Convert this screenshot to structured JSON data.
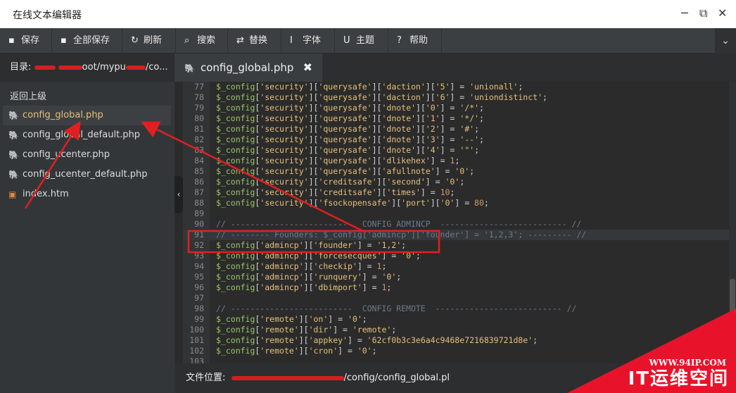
{
  "window": {
    "title": "在线文本编辑器",
    "min_icon": "─",
    "max_icon": "⧉",
    "close_icon": "✕"
  },
  "toolbar": {
    "buttons": [
      {
        "icon": "save-icon",
        "glyph": "▪",
        "label": "保存"
      },
      {
        "icon": "save-all-icon",
        "glyph": "▪",
        "label": "全部保存"
      },
      {
        "icon": "refresh-icon",
        "glyph": "↻",
        "label": "刷新"
      },
      {
        "icon": "search-icon",
        "glyph": "⌕",
        "label": "搜索"
      },
      {
        "icon": "replace-icon",
        "glyph": "⇄",
        "label": "替换"
      },
      {
        "icon": "font-icon",
        "glyph": "I",
        "label": "字体"
      },
      {
        "icon": "theme-icon",
        "glyph": "U",
        "label": "主题"
      },
      {
        "icon": "help-icon",
        "glyph": "?",
        "label": "帮助"
      }
    ],
    "more_glyph": "⌄"
  },
  "sidebar": {
    "dir_label": "目录:",
    "dir_mid": "oot/mypu",
    "dir_end": "/co...",
    "back": "返回上级",
    "files": [
      {
        "name": "config_global.php",
        "type": "php",
        "active": true
      },
      {
        "name": "config_global_default.php",
        "type": "php"
      },
      {
        "name": "config_ucenter.php",
        "type": "php"
      },
      {
        "name": "config_ucenter_default.php",
        "type": "php"
      },
      {
        "name": "index.htm",
        "type": "htm"
      }
    ],
    "collapse_glyph": "‹"
  },
  "tab": {
    "name": "config_global.php",
    "close": "✖"
  },
  "editor": {
    "lines": [
      {
        "n": "77",
        "t": "$_config['security']['querysafe']['daction']['5'] = 'unionall';"
      },
      {
        "n": "78",
        "t": "$_config['security']['querysafe']['daction']['6'] = 'uniondistinct';"
      },
      {
        "n": "79",
        "t": "$_config['security']['querysafe']['dnote']['0'] = '/*';"
      },
      {
        "n": "80",
        "t": "$_config['security']['querysafe']['dnote']['1'] = '*/';"
      },
      {
        "n": "81",
        "t": "$_config['security']['querysafe']['dnote']['2'] = '#';"
      },
      {
        "n": "82",
        "t": "$_config['security']['querysafe']['dnote']['3'] = '--';"
      },
      {
        "n": "83",
        "t": "$_config['security']['querysafe']['dnote']['4'] = '\"';"
      },
      {
        "n": "84",
        "t": "$_config['security']['querysafe']['dlikehex'] = 1;"
      },
      {
        "n": "85",
        "t": "$_config['security']['querysafe']['afullnote'] = '0';"
      },
      {
        "n": "86",
        "t": "$_config['security']['creditsafe']['second'] = '0';"
      },
      {
        "n": "87",
        "t": "$_config['security']['creditsafe']['times'] = 10;"
      },
      {
        "n": "88",
        "t": "$_config['security']['fsockopensafe']['port']['0'] = 80;"
      },
      {
        "n": "89",
        "t": ""
      },
      {
        "n": "90",
        "t": "// -------------------------  CONFIG ADMINCP  -------------------------- //"
      },
      {
        "n": "91",
        "t": "// -------- Founders: $_config['admincp']['founder'] = '1,2,3'; --------- //"
      },
      {
        "n": "92",
        "t": "$_config['admincp']['founder'] = '1,2';"
      },
      {
        "n": "93",
        "t": "$_config['admincp']['forcesecques'] = '0';"
      },
      {
        "n": "94",
        "t": "$_config['admincp']['checkip'] = 1;"
      },
      {
        "n": "95",
        "t": "$_config['admincp']['runquery'] = '0';"
      },
      {
        "n": "96",
        "t": "$_config['admincp']['dbimport'] = 1;"
      },
      {
        "n": "97",
        "t": ""
      },
      {
        "n": "98",
        "t": "// -------------------------  CONFIG REMOTE  -------------------------- //"
      },
      {
        "n": "99",
        "t": "$_config['remote']['on'] = '0';"
      },
      {
        "n": "100",
        "t": "$_config['remote']['dir'] = 'remote';"
      },
      {
        "n": "101",
        "t": "$_config['remote']['appkey'] = '62cf0b3c3e6a4c9468e7216839721d8e';"
      },
      {
        "n": "102",
        "t": "$_config['remote']['cron'] = '0';"
      },
      {
        "n": "103",
        "t": ""
      }
    ]
  },
  "status": {
    "label": "文件位置:",
    "path": "/config/config_global.pl"
  },
  "watermark": {
    "url": "WWW.94IP.COM",
    "text": "IT运维空间"
  },
  "colors": {
    "annotation": "#e02020",
    "active_file": "#e5c07b"
  }
}
